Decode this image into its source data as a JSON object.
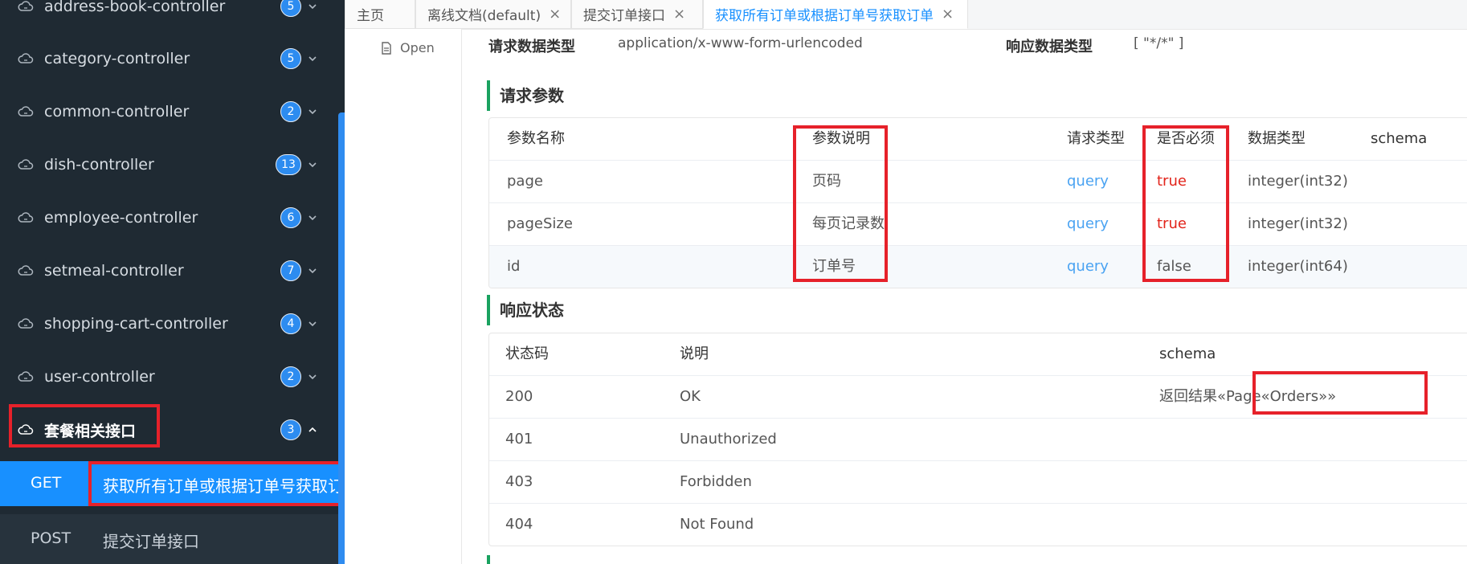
{
  "sidebar": {
    "controllers": [
      {
        "label": "address-book-controller",
        "count": "5"
      },
      {
        "label": "category-controller",
        "count": "5"
      },
      {
        "label": "common-controller",
        "count": "2"
      },
      {
        "label": "dish-controller",
        "count": "13"
      },
      {
        "label": "employee-controller",
        "count": "6"
      },
      {
        "label": "setmeal-controller",
        "count": "7"
      },
      {
        "label": "shopping-cart-controller",
        "count": "4"
      },
      {
        "label": "user-controller",
        "count": "2"
      },
      {
        "label": "套餐相关接口",
        "count": "3"
      }
    ],
    "apis": [
      {
        "method": "GET",
        "label": "获取所有订单或根据订单号获取订单"
      },
      {
        "method": "POST",
        "label": "提交订单接口"
      }
    ]
  },
  "tabs": [
    {
      "label": "主页"
    },
    {
      "label": "离线文档(default)"
    },
    {
      "label": "提交订单接口"
    },
    {
      "label": "获取所有订单或根据订单号获取订单"
    }
  ],
  "left_panel": {
    "open_label": "Open"
  },
  "request_info": {
    "req_type_label": "请求数据类型",
    "req_type_value": "application/x-www-form-urlencoded",
    "resp_type_label": "响应数据类型",
    "resp_type_value": "[ \"*/*\" ]"
  },
  "params_section": {
    "title": "请求参数",
    "headers": [
      "参数名称",
      "参数说明",
      "请求类型",
      "是否必须",
      "数据类型",
      "schema"
    ],
    "rows": [
      {
        "name": "page",
        "desc": "页码",
        "in": "query",
        "required": "true",
        "type": "integer(int32)",
        "schema": ""
      },
      {
        "name": "pageSize",
        "desc": "每页记录数",
        "in": "query",
        "required": "true",
        "type": "integer(int32)",
        "schema": ""
      },
      {
        "name": "id",
        "desc": "订单号",
        "in": "query",
        "required": "false",
        "type": "integer(int64)",
        "schema": ""
      }
    ]
  },
  "response_section": {
    "title": "响应状态",
    "headers": [
      "状态码",
      "说明",
      "schema"
    ],
    "rows": [
      {
        "code": "200",
        "desc": "OK",
        "schema": "返回结果«Page«Orders»»"
      },
      {
        "code": "401",
        "desc": "Unauthorized",
        "schema": ""
      },
      {
        "code": "403",
        "desc": "Forbidden",
        "schema": ""
      },
      {
        "code": "404",
        "desc": "Not Found",
        "schema": ""
      }
    ]
  },
  "colors": {
    "sidebar_bg": "#1f2a33",
    "accent_blue": "#1890ff",
    "highlight_red": "#e6212a",
    "section_green": "#1aa260",
    "query_blue": "#4aa3f2",
    "required_red": "#e2231a"
  },
  "icons": {
    "controller_icon": "cloud-icon",
    "chevron": "chevron-down-icon",
    "chevron_open": "chevron-up-icon",
    "tab_close": "close-icon",
    "open_icon": "document-icon"
  }
}
